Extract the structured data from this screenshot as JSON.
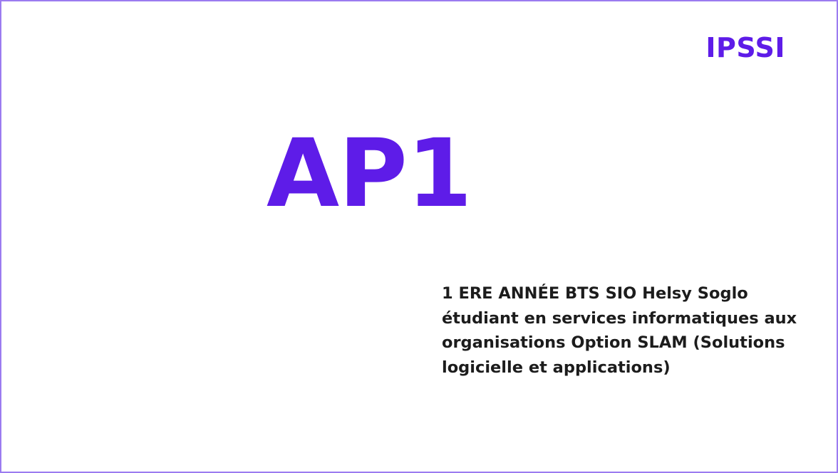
{
  "colors": {
    "accent": "#5e1ce8",
    "border": "#9b7bf0",
    "text": "#1c1c1c",
    "background": "#ffffff"
  },
  "slide": {
    "brand": "IPSSI",
    "title": "AP1",
    "description": "1 ERE ANNÉE BTS SIO Helsy Soglo étudiant en services informatiques aux organisations Option SLAM (Solutions logicielle et applications)"
  }
}
